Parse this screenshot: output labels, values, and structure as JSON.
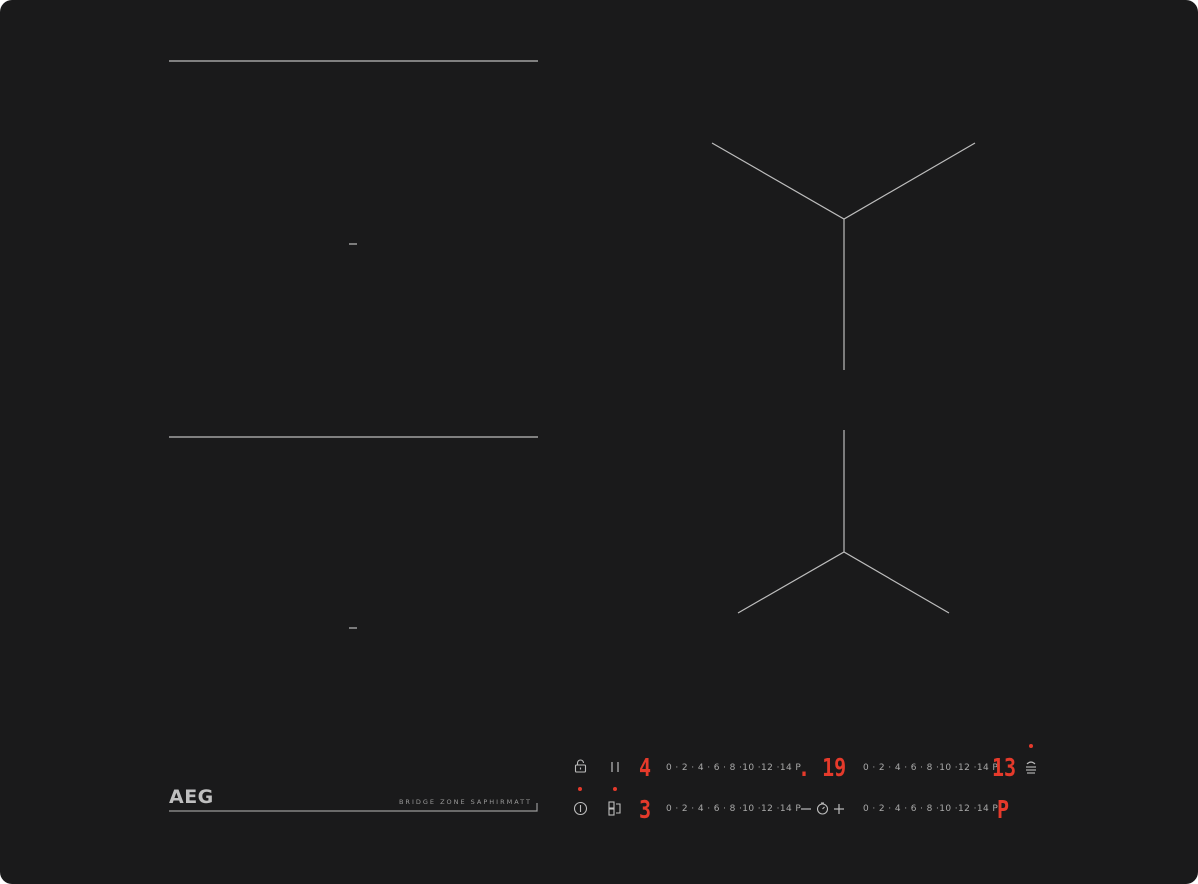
{
  "brand": {
    "logo_text": "AEG",
    "model_text": "BRIDGE ZONE SAPHIRMATT"
  },
  "colors": {
    "glass": "#1a1a1b",
    "lines": "#bdbdbd",
    "display_red": "#e53a2b"
  },
  "controls": {
    "top_row": {
      "icons": [
        "lock-icon",
        "pause-icon"
      ],
      "left_zone": {
        "power_display": "4",
        "scale": "0 · 2 · 4 · 6 · 8 ·10 ·12 ·14 P"
      },
      "timer_display": ". 19",
      "right_zone": {
        "power_display": "13",
        "scale": "0 · 2 · 4 · 6 · 8 ·10 ·12 ·14 P"
      },
      "right_icon": "hob2hood-icon"
    },
    "bottom_row": {
      "icons": [
        "power-icon",
        "bridge-icon"
      ],
      "left_zone": {
        "power_display": "3",
        "scale": "0 · 2 · 4 · 6 · 8 ·10 ·12 ·14 P"
      },
      "timer_controls": [
        "minus-icon",
        "timer-icon",
        "plus-icon"
      ],
      "right_zone": {
        "power_display": "P",
        "scale": "0 · 2 · 4 · 6 · 8 ·10 ·12 ·14 P"
      }
    }
  }
}
